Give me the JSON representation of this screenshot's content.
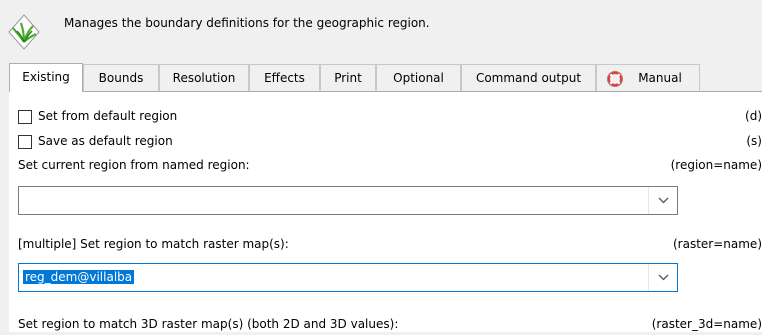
{
  "header": {
    "description": "Manages the boundary definitions for the geographic region."
  },
  "tabs": [
    {
      "label": "Existing",
      "active": true
    },
    {
      "label": "Bounds"
    },
    {
      "label": "Resolution"
    },
    {
      "label": "Effects"
    },
    {
      "label": "Print"
    },
    {
      "label": "Optional"
    },
    {
      "label": "Command output"
    },
    {
      "label": "Manual",
      "icon": "lifebuoy-icon"
    }
  ],
  "options": {
    "set_default": {
      "label": "Set from default region",
      "flag": "(d)",
      "checked": false
    },
    "save_default": {
      "label": "Save as default region",
      "flag": "(s)",
      "checked": false
    }
  },
  "region_name": {
    "label": "Set current region from named region:",
    "param": "(region=name)",
    "value": ""
  },
  "raster": {
    "label": "[multiple] Set region to match raster map(s):",
    "param": "(raster=name)",
    "value": "reg_dem@villalba"
  },
  "raster3d": {
    "label": "Set region to match 3D raster map(s) (both 2D and 3D values):",
    "param": "(raster_3d=name)"
  },
  "colors": {
    "accent": "#0078d7",
    "logo_green": "#4caf2a",
    "lifebuoy_red": "#e04040"
  }
}
